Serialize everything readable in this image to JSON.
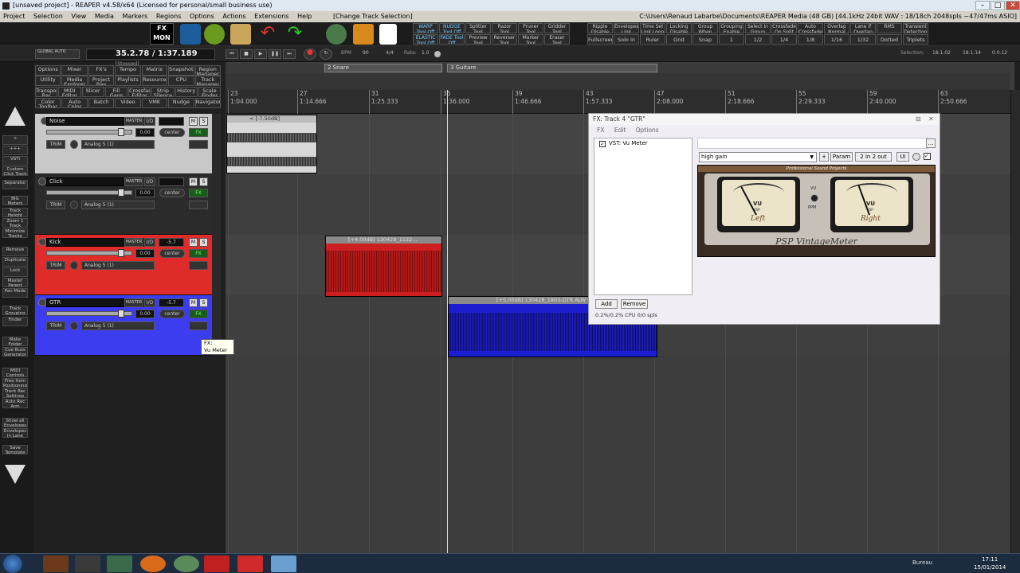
{
  "window": {
    "title": "[unsaved project] - REAPER v4.58/x64 (Licensed for personal/small business use)",
    "minimize": "–",
    "maximize": "□",
    "close": "✕"
  },
  "menu": {
    "items": [
      "Project",
      "Selection",
      "View",
      "Media",
      "Markers",
      "Regions",
      "Options",
      "Actions",
      "Extensions",
      "Help"
    ],
    "change_track": "[Change Track Selection]",
    "path": "C:\\Users\\Renaud Labarbe\\Documents\\REAPER Media (48 GB) [44.1kHz 24bit WAV : 18/18ch 2048spls ~47/47ms ASIO]"
  },
  "toolbar": {
    "fx_mon": "FX MON",
    "tools": [
      "WARP Tool Off",
      "NUDGE Tool Off",
      "Splitter Tool",
      "Razor Tool",
      "Pruner Tool",
      "Gridder Tool",
      "ELASTIC Tool Off",
      "FADE Tool Off",
      "Preview Tool",
      "Reverser Tool",
      "Marker Tool",
      "Eraser Tool"
    ],
    "right_top": [
      "Ripple Disable",
      "Envelopes Link Items",
      "Time Sel Link Loop",
      "Locking Disable",
      "Group When Rec",
      "Grouping Enable",
      "Select In Group",
      "Crossfade On Split",
      "Auto Crossfade",
      "Overlap Normal",
      "Lane if Overlap",
      "RMS",
      "Transient Detection"
    ],
    "right_bottom": [
      "Fullscreen",
      "Solo In Front",
      "Ruler Unit",
      "Grid",
      "Snap",
      "1",
      "1/2",
      "1/4",
      "1/8",
      "1/16",
      "1/32",
      "Dotted",
      "Triplets"
    ]
  },
  "transport": {
    "global_auto": "GLOBAL AUTO",
    "time": "35.2.78 / 1:37.189",
    "state": "[Stopped]",
    "bpm_label": "BPM",
    "bpm": "90",
    "sig": "4/4",
    "rate_label": "Rate:",
    "rate": "1.0",
    "selection_label": "Selection:",
    "sel_start": "18.1.02",
    "sel_end": "18.1.14",
    "sel_len": "0.0.12"
  },
  "action_grid": [
    [
      "Options",
      "Mixer",
      "FX's",
      "Tempo",
      "Matrix",
      "Snapshot",
      "Region Manager"
    ],
    [
      "Utility",
      "Media Explorer",
      "Project Bay",
      "Playlists",
      "Resource",
      "CPU",
      "Track Manager"
    ],
    [
      "Transport Bar",
      "MIDI Editor",
      "Slicer",
      "Fill Gaps",
      "Crossfade Editor",
      "Strip Silence",
      "History",
      "Scale Finder"
    ],
    [
      "Color Toolbar",
      "Auto Color Icon",
      "Batch",
      "Video",
      "VMK",
      "Nudge",
      "Navigator"
    ]
  ],
  "left_panel": [
    "+",
    "+++",
    "VSTi",
    "Custom Click Track",
    "Separator",
    "BIG Meters",
    "Track Height",
    "Zoom 1 Track",
    "Minimize Tracks",
    "Remove",
    "Duplicate",
    "Lock",
    "Master Parent",
    "Pan Mode",
    "Track Grouping",
    "Finder",
    "Make Folder",
    "Cue Buss Generator",
    "MIDI Controls",
    "Free Item Positioning",
    "Track Rec Settings",
    "Auto Rec Arm",
    "Show all Envelopes",
    "Envelopes In Lane",
    "Save Template"
  ],
  "tracks": [
    {
      "name": "Noise",
      "vol": "0.00",
      "pan": "center",
      "input": "Analog 5 (1)",
      "color": "#c8c8c8",
      "fx": "FX"
    },
    {
      "name": "Click",
      "vol": "0.00",
      "pan": "center",
      "input": "Analog 5 (1)",
      "color": "#2b2b2b",
      "fx": "FX"
    },
    {
      "name": "Kick",
      "vol": "0.00",
      "pan": "center",
      "input": "Analog 5 (1)",
      "color": "#e02b2b",
      "fx": "FX",
      "meter": "-5.7"
    },
    {
      "name": "GTR",
      "vol": "0.00",
      "pan": "center",
      "input": "Analog 5 (1)",
      "color": "#3c3cf0",
      "fx": "FX",
      "meter": "-5.7"
    }
  ],
  "tcp_labels": {
    "master": "MASTER",
    "io": "I/O",
    "m": "M",
    "s": "S",
    "trim": "TRIM"
  },
  "ruler": {
    "bars": [
      "23",
      "27",
      "31",
      "35",
      "39",
      "43",
      "47",
      "51",
      "55",
      "59",
      "63"
    ],
    "times": [
      "1:04.000",
      "1:14.666",
      "1:25.333",
      "1:36.000",
      "1:46.666",
      "1:57.333",
      "2:08.000",
      "2:18.666",
      "2:29.333",
      "2:40.000",
      "2:50.666"
    ],
    "regions": [
      "2 Snare",
      "3 Guitare"
    ]
  },
  "items": {
    "noise": "< [-7.50dB]",
    "kick": "[+4.00dB] 130428_1122...",
    "gtr": "[+5.00dB] 130428_1803-GTR ALW"
  },
  "fx_window": {
    "title": "FX: Track 4 \"GTR\"",
    "menu": [
      "FX",
      "Edit",
      "Options"
    ],
    "plugin": "VST: Vu Meter",
    "preset": "high gain",
    "plus": "+",
    "param": "Param",
    "io": "2 in 2 out",
    "ui": "UI",
    "add": "Add",
    "remove": "Remove",
    "cpu": "0.2%/0.2% CPU 0/0 spls",
    "psp_top": "Professional Sound Projects",
    "psp_name": "PSP VintageMeter",
    "left": "Left",
    "right": "Right",
    "vu": "VU",
    "ppm": "PPM",
    "vsp": "VSP"
  },
  "tooltip": {
    "line1": "FX:",
    "line2": "Vu Meter"
  },
  "taskbar": {
    "lang": "Bureau",
    "time": "17:11",
    "date": "15/01/2014"
  }
}
